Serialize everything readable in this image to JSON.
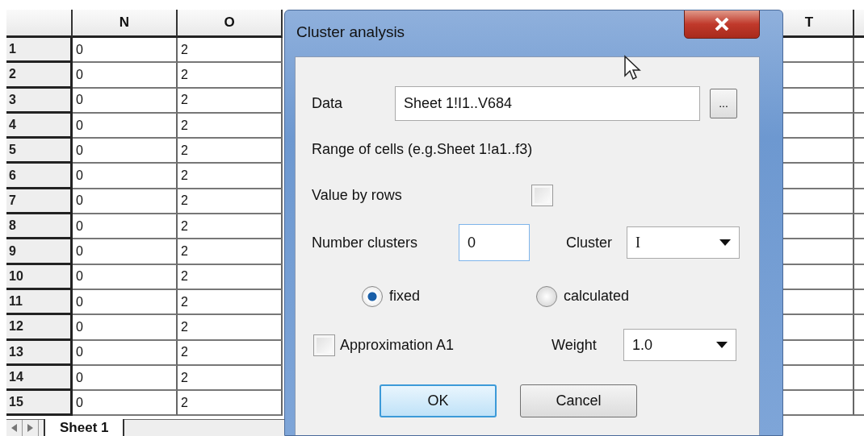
{
  "spreadsheet": {
    "left_columns": [
      "N",
      "O"
    ],
    "right_columns": [
      "T"
    ],
    "rows": [
      {
        "number": "1",
        "cells": [
          "0",
          "2"
        ]
      },
      {
        "number": "2",
        "cells": [
          "0",
          "2"
        ]
      },
      {
        "number": "3",
        "cells": [
          "0",
          "2"
        ]
      },
      {
        "number": "4",
        "cells": [
          "0",
          "2"
        ]
      },
      {
        "number": "5",
        "cells": [
          "0",
          "2"
        ]
      },
      {
        "number": "6",
        "cells": [
          "0",
          "2"
        ]
      },
      {
        "number": "7",
        "cells": [
          "0",
          "2"
        ]
      },
      {
        "number": "8",
        "cells": [
          "0",
          "2"
        ]
      },
      {
        "number": "9",
        "cells": [
          "0",
          "2"
        ]
      },
      {
        "number": "10",
        "cells": [
          "0",
          "2"
        ]
      },
      {
        "number": "11",
        "cells": [
          "0",
          "2"
        ]
      },
      {
        "number": "12",
        "cells": [
          "0",
          "2"
        ]
      },
      {
        "number": "13",
        "cells": [
          "0",
          "2"
        ]
      },
      {
        "number": "14",
        "cells": [
          "0",
          "2"
        ]
      },
      {
        "number": "15",
        "cells": [
          "0",
          "2"
        ]
      }
    ]
  },
  "sheet_tabs": [
    {
      "label": "Sheet 1",
      "selected": true
    }
  ],
  "dialog": {
    "title": "Cluster analysis",
    "data": {
      "label": "Data",
      "value": "Sheet 1!I1..V684",
      "browse": "..."
    },
    "hint": "Range of cells (e.g.Sheet 1!a1..f3)",
    "value_by_rows": {
      "label": "Value by rows",
      "checked": false
    },
    "number_clusters": {
      "label": "Number clusters",
      "value": "0"
    },
    "cluster": {
      "label": "Cluster",
      "value": "I"
    },
    "modes": [
      {
        "label": "fixed",
        "selected": true
      },
      {
        "label": "calculated",
        "selected": false
      }
    ],
    "approximation": {
      "label": "Approximation A1",
      "checked": false
    },
    "weight": {
      "label": "Weight",
      "value": "1.0"
    },
    "buttons": [
      {
        "label": "OK",
        "kind": "default"
      },
      {
        "label": "Cancel",
        "kind": "normal"
      }
    ]
  }
}
